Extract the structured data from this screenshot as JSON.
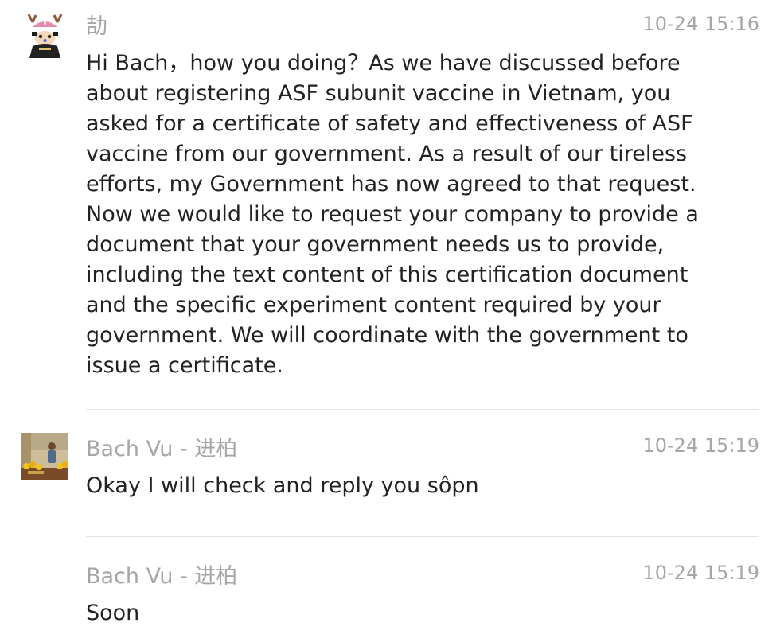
{
  "messages": [
    {
      "sender": "劼",
      "time": "10-24 15:16",
      "avatar_icon": "cartoon-reindeer-avatar-icon",
      "text": "Hi Bach，how you doing？As we have discussed before about registering ASF subunit vaccine in Vietnam, you asked for a certificate of safety and effectiveness of ASF vaccine from our government. As a result of our tireless efforts, my Government has now agreed to that request. Now we would like to request your company to provide a document that your government needs us to provide, including the text content of this certification document and the specific experiment content required by your government. We will coordinate with the government to issue a certificate."
    },
    {
      "sender": "Bach Vu - 进柏",
      "time": "10-24 15:19",
      "avatar_icon": "person-photo-avatar-icon",
      "text": "Okay I will check and reply you sôpn"
    },
    {
      "sender": "Bach Vu - 进柏",
      "time": "10-24 15:19",
      "text": "Soon"
    }
  ],
  "colors": {
    "meta_text": "#a6a6a6",
    "body_text": "#222222",
    "divider": "#e3e3e3",
    "background": "#ffffff"
  }
}
